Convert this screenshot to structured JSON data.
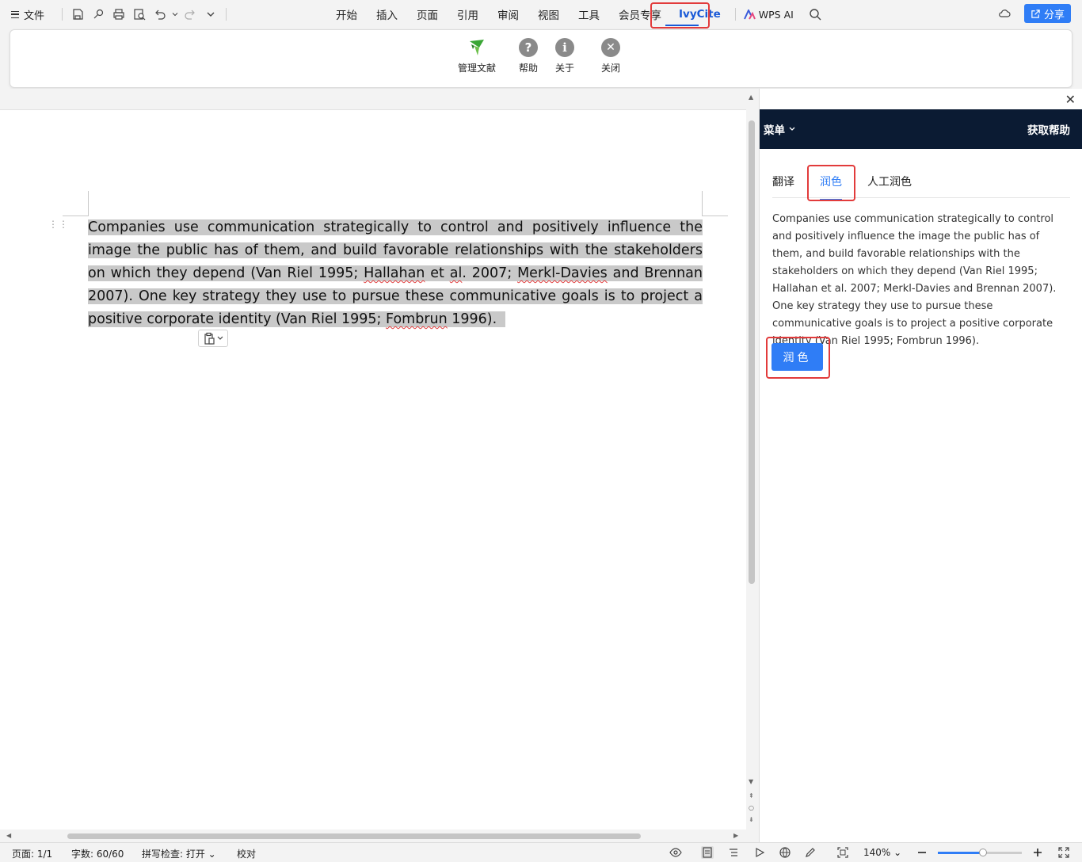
{
  "topbar": {
    "file_label": "文件",
    "tabs": [
      "开始",
      "插入",
      "页面",
      "引用",
      "审阅",
      "视图",
      "工具",
      "会员专享"
    ],
    "active_tab": "IvyCite",
    "wps_ai_label": "WPS AI",
    "share_label": "分享"
  },
  "ribbon": {
    "manage_label": "管理文献",
    "help_label": "帮助",
    "about_label": "关于",
    "close_label": "关闭"
  },
  "document": {
    "text_before_hallahan": "Companies use communication strategically to control and positively influence the image the public has of them, and build favorable relationships with the stakeholders on which they depend (Van Riel 1995; ",
    "hallahan": "Hallahan",
    "et": " et ",
    "al": "al",
    "after_al": ". 2007; ",
    "merkl": "Merkl-Davies",
    "text_after_merkl": " and Brennan 2007). One key strategy they use to pursue these communicative goals is to project a positive corporate identity (Van Riel 1995; ",
    "fombrun": "Fombrun",
    "text_end": " 1996)."
  },
  "panel": {
    "menu_label": "菜单",
    "help_label": "获取帮助",
    "tabs": [
      "翻译",
      "润色",
      "人工润色"
    ],
    "active_tab_index": 1,
    "content": "Companies use communication strategically to control and positively influence the image the public has of them, and build favorable relationships with the stakeholders on which they depend (Van Riel 1995; Hallahan et al. 2007; Merkl-Davies and Brennan 2007). One key strategy they use to pursue these communicative goals is to project a positive corporate identity (Van Riel 1995; Fombrun 1996).",
    "polish_button": "润色"
  },
  "statusbar": {
    "page": "页面: 1/1",
    "word_count": "字数: 60/60",
    "spell_check": "拼写检查: 打开",
    "proofread": "校对",
    "zoom": "140%"
  },
  "colors": {
    "accent": "#2f7df6",
    "highlight_box": "#e23b3b",
    "panel_header": "#0b1b33",
    "selection": "#c9c9c9"
  }
}
